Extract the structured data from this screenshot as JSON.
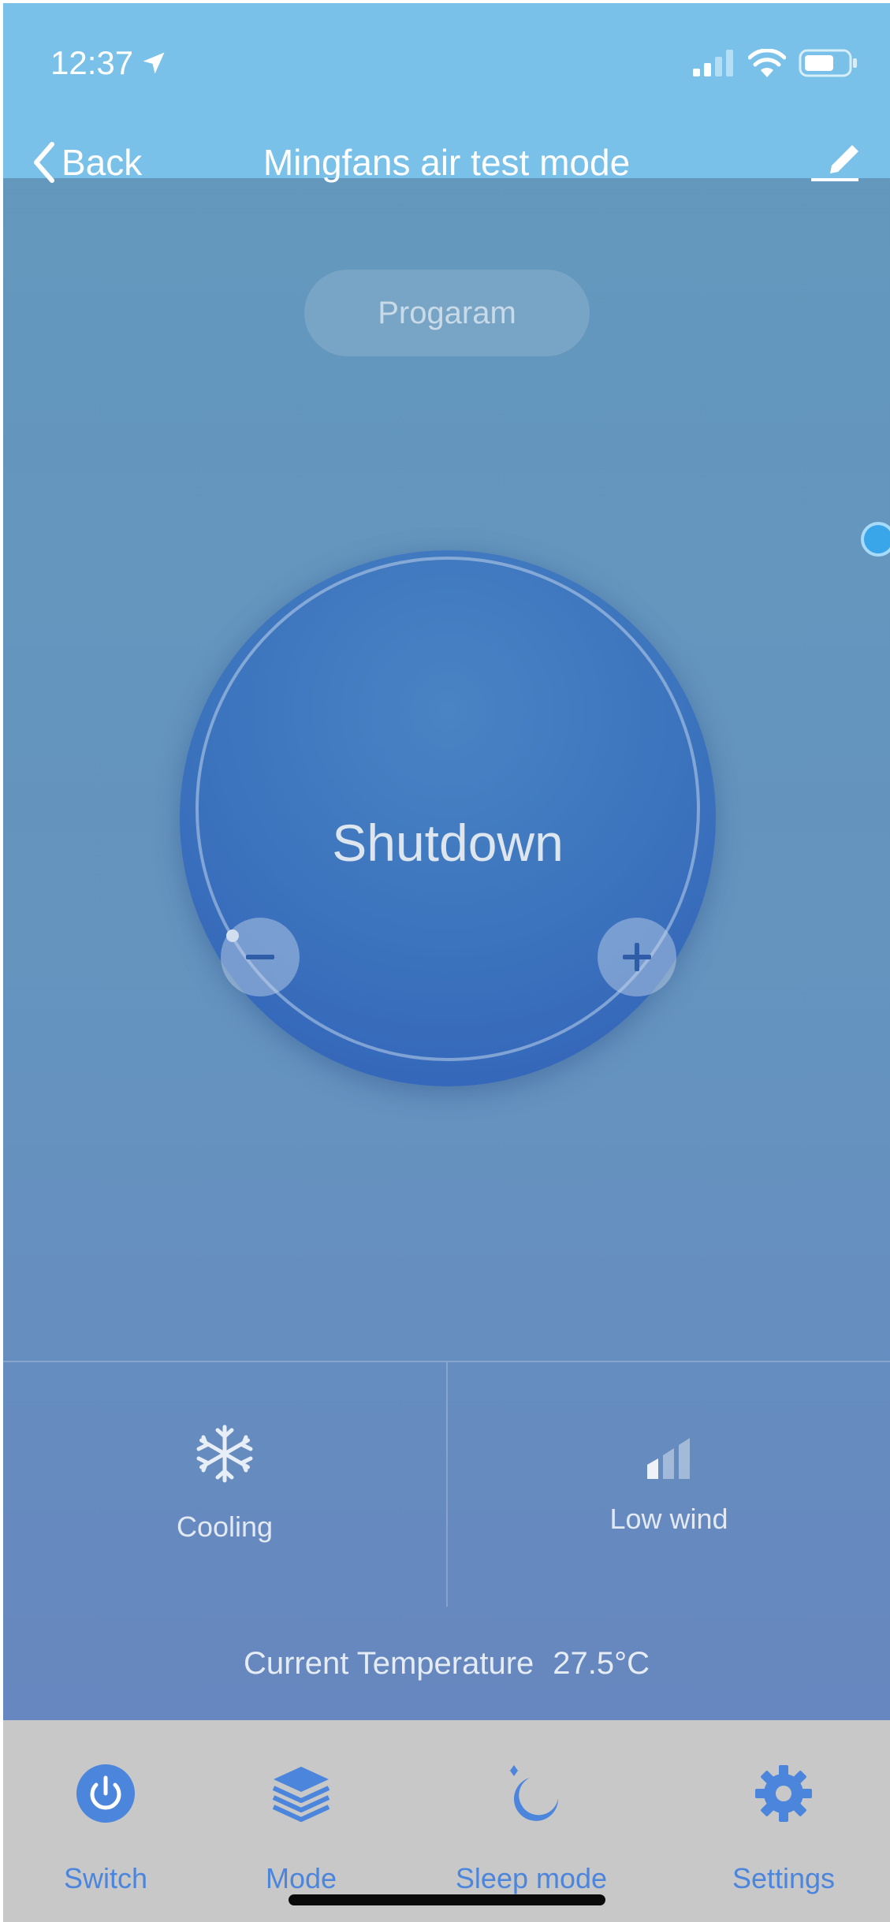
{
  "status_bar": {
    "time": "12:37",
    "location_icon": "location-arrow-icon",
    "signal_icon": "cellular-signal-icon",
    "wifi_icon": "wifi-icon",
    "battery_icon": "battery-icon"
  },
  "nav": {
    "back_label": "Back",
    "title": "Mingfans air test mode",
    "edit_icon": "edit-pencil-icon"
  },
  "program_button": "Progaram",
  "dial": {
    "status": "Shutdown",
    "minus_icon": "minus-icon",
    "plus_icon": "plus-icon"
  },
  "panels": {
    "mode": {
      "label": "Cooling",
      "icon": "snowflake-icon"
    },
    "wind": {
      "label": "Low wind",
      "icon": "wind-level-icon"
    }
  },
  "current_temperature": {
    "label": "Current Temperature",
    "value": "27.5°C"
  },
  "tabbar": {
    "items": [
      {
        "label": "Switch",
        "icon": "power-icon"
      },
      {
        "label": "Mode",
        "icon": "layers-icon"
      },
      {
        "label": "Sleep mode",
        "icon": "moon-icon"
      },
      {
        "label": "Settings",
        "icon": "gear-icon"
      }
    ]
  },
  "colors": {
    "header": "#79c1e9",
    "background_top": "#6399bc",
    "background_bottom": "#6783bf",
    "dial": "#3c74bd",
    "accent": "#4b85dc",
    "tabbar": "#c8c8c8"
  }
}
